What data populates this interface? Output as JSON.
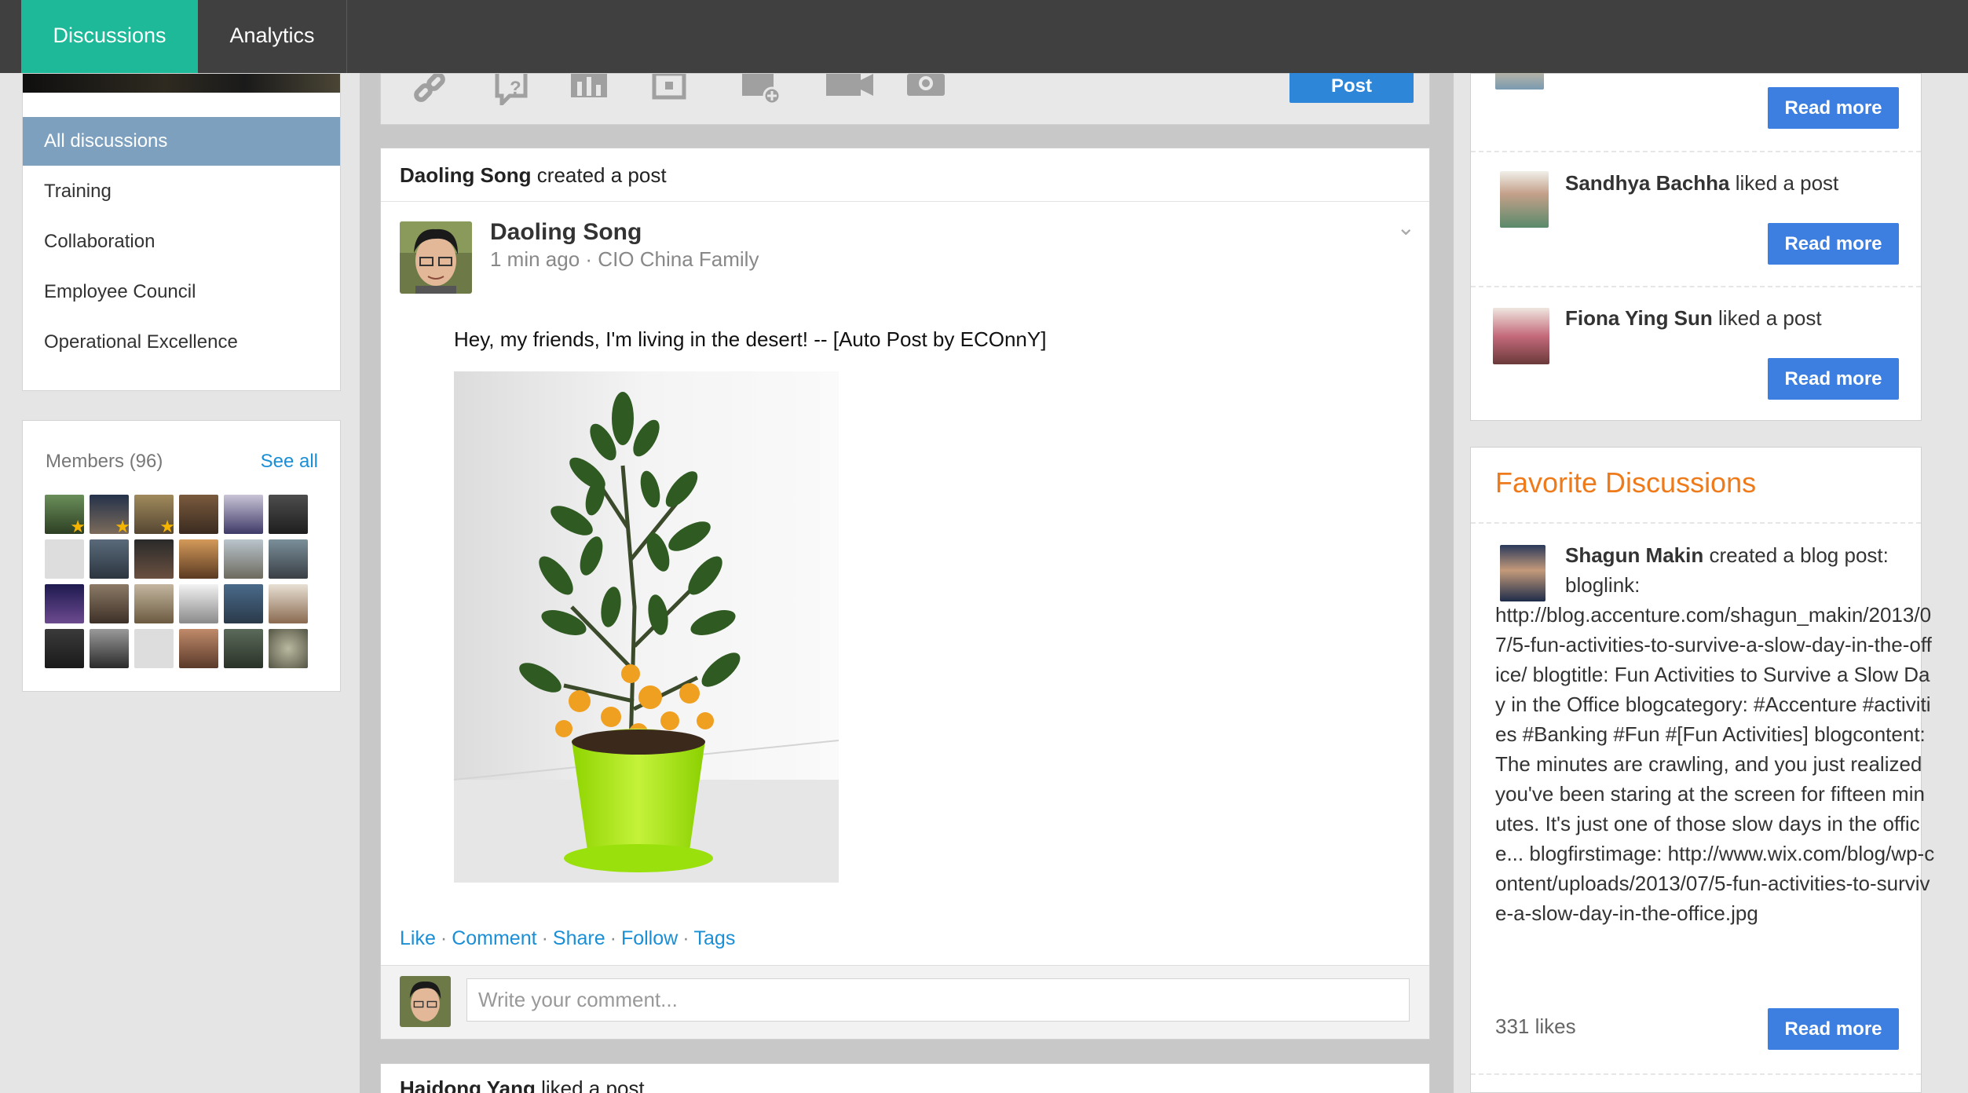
{
  "topnav": {
    "tabs": [
      {
        "label": "Discussions"
      },
      {
        "label": "Analytics"
      }
    ]
  },
  "sidebar": {
    "items": [
      {
        "label": "All discussions"
      },
      {
        "label": "Training"
      },
      {
        "label": "Collaboration"
      },
      {
        "label": "Employee Council"
      },
      {
        "label": "Operational Excellence"
      }
    ]
  },
  "members": {
    "title": "Members (96)",
    "see_all": "See all"
  },
  "composer": {
    "post_label": "Post",
    "tools": [
      "link-icon",
      "question-icon",
      "poll-icon",
      "embed-icon",
      "event-icon",
      "video-icon",
      "camera-icon"
    ]
  },
  "post": {
    "header_actor": "Daoling Song",
    "header_action": "created a post",
    "author": "Daoling Song",
    "meta": "1 min ago · CIO China Family",
    "text": "Hey, my friends, I'm living in the desert! -- [Auto Post by ECOnnY]",
    "actions": [
      "Like",
      "Comment",
      "Share",
      "Follow",
      "Tags"
    ],
    "comment_placeholder": "Write your comment..."
  },
  "next_post": {
    "actor": "Haidong Yang",
    "action": "liked a post"
  },
  "activity": [
    {
      "name": "",
      "action": "",
      "button": "Read more"
    },
    {
      "name": "Sandhya Bachha",
      "action": "liked a post",
      "button": "Read more"
    },
    {
      "name": "Fiona Ying Sun",
      "action": "liked a post",
      "button": "Read more"
    }
  ],
  "favorites": {
    "title": "Favorite Discussions",
    "item": {
      "name": "Shagun Makin",
      "action": "created a blog post: bloglink:",
      "body": "http://blog.accenture.com/shagun_makin/2013/07/5-fun-activities-to-survive-a-slow-day-in-the-office/ blogtitle: Fun Activities to Survive a Slow Day in the Office blogcategory: #Accenture #activities #Banking #Fun #[Fun Activities] blogcontent: The minutes are crawling, and you just realized you've been staring at the screen for fifteen minutes. It's just one of those slow days in the office... blogfirstimage: http://www.wix.com/blog/wp-content/uploads/2013/07/5-fun-activities-to-survive-a-slow-day-in-the-office.jpg",
      "likes": "331 likes",
      "button": "Read more"
    }
  },
  "colors": {
    "accent": "#1db998",
    "link": "#1a8fd6",
    "button": "#3d7fe0",
    "favorite_title": "#ef7a1a",
    "nav_active": "#7da0bf"
  }
}
